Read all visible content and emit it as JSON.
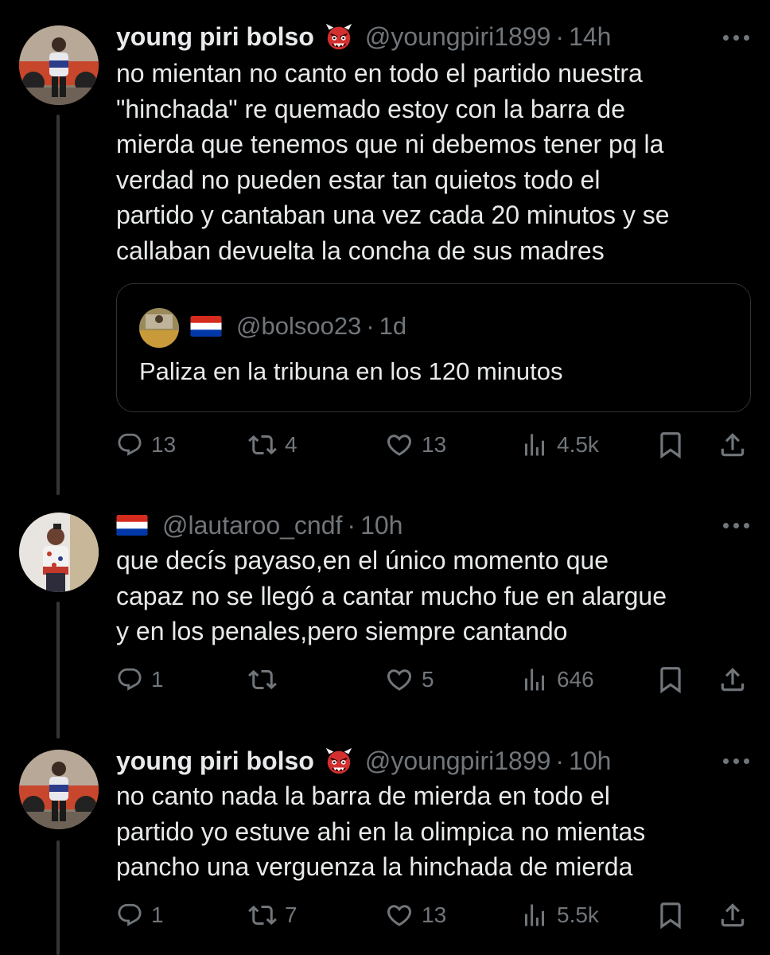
{
  "tweets": [
    {
      "name": "young piri bolso",
      "handle": "@youngpiri1899",
      "dot": "·",
      "time": "14h",
      "text": "no mientan no canto en todo el partido nuestra\n\"hinchada\" re quemado estoy con la barra de\nmierda que tenemos que ni debemos tener pq la\nverdad no pueden estar tan quietos todo el\npartido y cantaban una vez cada 20 minutos y se\ncallaban devuelta la concha de sus madres",
      "quote": {
        "handle": "@bolsoo23",
        "dot": "·",
        "time": "1d",
        "text": "Paliza en la tribuna en los 120 minutos"
      },
      "replies": "13",
      "retweets": "4",
      "likes": "13",
      "views": "4.5k"
    },
    {
      "name": "",
      "handle": "@lautaroo_cndf",
      "dot": "·",
      "time": "10h",
      "text": "que decís payaso,en el único momento que\ncapaz no se llegó a cantar mucho fue en alargue\ny en los penales,pero siempre cantando",
      "replies": "1",
      "retweets": "",
      "likes": "5",
      "views": "646"
    },
    {
      "name": "young piri bolso",
      "handle": "@youngpiri1899",
      "dot": "·",
      "time": "10h",
      "text": "no canto nada la barra de mierda en todo el\npartido yo estuve ahi en la olimpica no mientas\npancho una verguenza la hinchada de mierda",
      "replies": "1",
      "retweets": "7",
      "likes": "13",
      "views": "5.5k"
    }
  ],
  "icons": {
    "emoji": "ogre-emoji-icon",
    "flag": "paraguay-flag-icon",
    "reply": "reply-icon",
    "retweet": "retweet-icon",
    "like": "heart-icon",
    "views": "views-icon",
    "bookmark": "bookmark-icon",
    "share": "share-icon"
  },
  "colors": {
    "background": "#000000",
    "text": "#e7e9ea",
    "secondary": "#71767b",
    "border": "#2f3336",
    "emoji_red": "#d32f2f",
    "flag_red": "#d52b1e",
    "flag_blue": "#0038a8"
  }
}
